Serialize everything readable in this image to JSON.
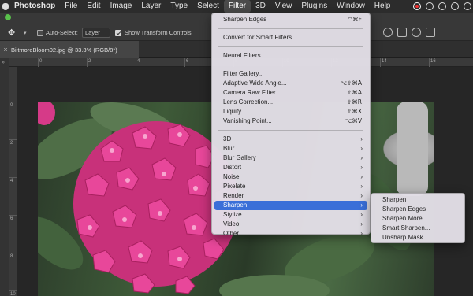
{
  "menubar": {
    "app": "Photoshop",
    "items": [
      "File",
      "Edit",
      "Image",
      "Layer",
      "Type",
      "Select",
      "Filter",
      "3D",
      "View",
      "Plugins",
      "Window",
      "Help"
    ],
    "active": "Filter"
  },
  "options_bar": {
    "auto_select_label": "Auto-Select:",
    "auto_select_value": "Layer",
    "show_transform_label": "Show Transform Controls",
    "auto_select_checked": false,
    "show_transform_checked": true
  },
  "document_tab": {
    "title": "BiltmoreBloom02.jpg @ 33.3% (RGB/8*)",
    "close": "×"
  },
  "ruler": {
    "top_labels": [
      "0",
      "2",
      "4",
      "6",
      "8",
      "10",
      "12",
      "14",
      "16"
    ],
    "left_labels": [
      "0",
      "2",
      "4",
      "6",
      "8",
      "10"
    ]
  },
  "filter_menu": {
    "groups": [
      [
        {
          "label": "Sharpen Edges",
          "shortcut": "^⌘F"
        }
      ],
      [
        {
          "label": "Convert for Smart Filters",
          "shortcut": ""
        }
      ],
      [
        {
          "label": "Neural Filters...",
          "shortcut": ""
        }
      ],
      [
        {
          "label": "Filter Gallery...",
          "shortcut": ""
        },
        {
          "label": "Adaptive Wide Angle...",
          "shortcut": "⌥⇧⌘A"
        },
        {
          "label": "Camera Raw Filter...",
          "shortcut": "⇧⌘A"
        },
        {
          "label": "Lens Correction...",
          "shortcut": "⇧⌘R"
        },
        {
          "label": "Liquify...",
          "shortcut": "⇧⌘X"
        },
        {
          "label": "Vanishing Point...",
          "shortcut": "⌥⌘V"
        }
      ],
      [
        {
          "label": "3D",
          "submenu": true
        },
        {
          "label": "Blur",
          "submenu": true
        },
        {
          "label": "Blur Gallery",
          "submenu": true
        },
        {
          "label": "Distort",
          "submenu": true
        },
        {
          "label": "Noise",
          "submenu": true
        },
        {
          "label": "Pixelate",
          "submenu": true
        },
        {
          "label": "Render",
          "submenu": true
        },
        {
          "label": "Sharpen",
          "submenu": true,
          "highlighted": true
        },
        {
          "label": "Stylize",
          "submenu": true
        },
        {
          "label": "Video",
          "submenu": true
        },
        {
          "label": "Other",
          "submenu": true
        }
      ]
    ]
  },
  "sharpen_submenu": {
    "items": [
      "Sharpen",
      "Sharpen Edges",
      "Sharpen More",
      "Smart Sharpen...",
      "Unsharp Mask..."
    ]
  },
  "colors": {
    "highlight": "#3a6fd8",
    "traffic_green": "#59c14b",
    "flower_pink": "#e8479a"
  }
}
